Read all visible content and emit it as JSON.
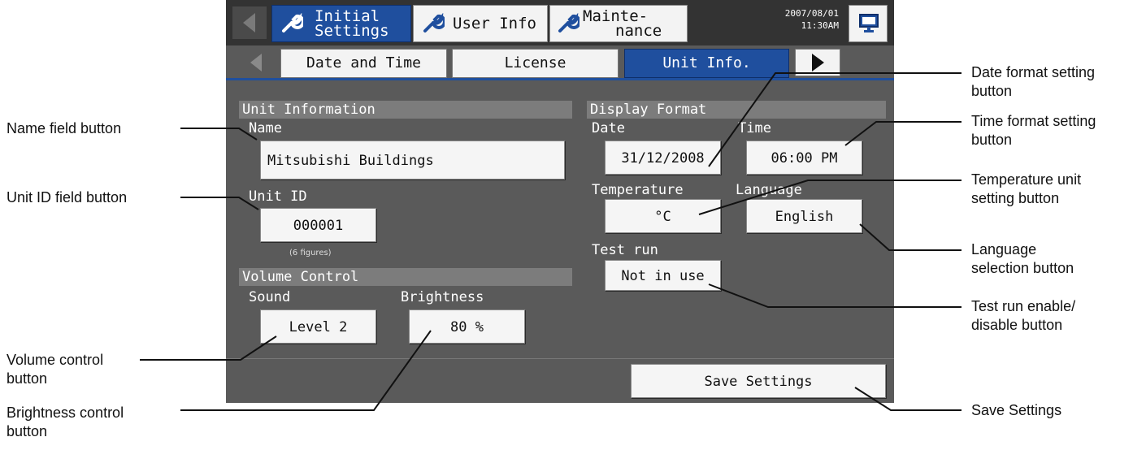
{
  "nav": {
    "tabs": [
      {
        "line1": "Initial",
        "line2": "Settings",
        "active": true
      },
      {
        "line1": "User Info",
        "line2": "",
        "active": false
      },
      {
        "line1": "Mainte-",
        "line2": "nance",
        "active": false
      }
    ],
    "clock": {
      "date": "2007/08/01",
      "time": "11:30AM"
    }
  },
  "subtabs": [
    "Date and Time",
    "License",
    "Unit Info."
  ],
  "unit_info": {
    "section_title": "Unit Information",
    "name_label": "Name",
    "name_value": "Mitsubishi Buildings",
    "unit_id_label": "Unit ID",
    "unit_id_value": "000001",
    "unit_id_note": "(6 figures)"
  },
  "volume": {
    "section_title": "Volume Control",
    "sound_label": "Sound",
    "sound_value": "Level 2",
    "brightness_label": "Brightness",
    "brightness_value": "80 %"
  },
  "display_format": {
    "section_title": "Display Format",
    "date_label": "Date",
    "date_value": "31/12/2008",
    "time_label": "Time",
    "time_value": "06:00 PM",
    "temperature_label": "Temperature",
    "temperature_value": "°C",
    "language_label": "Language",
    "language_value": "English",
    "testrun_label": "Test run",
    "testrun_value": "Not in use"
  },
  "save_label": "Save Settings",
  "callouts": {
    "name": "Name field button",
    "unit_id": "Unit ID field button",
    "volume_l1": "Volume control",
    "volume_l2": "button",
    "brightness_l1": "Brightness control",
    "brightness_l2": "button",
    "date_l1": "Date format setting",
    "date_l2": "button",
    "time_l1": "Time format setting",
    "time_l2": "button",
    "temp_l1": "Temperature unit",
    "temp_l2": "setting button",
    "lang_l1": "Language",
    "lang_l2": "selection button",
    "test_l1": "Test run enable/",
    "test_l2": "disable button",
    "save": "Save Settings"
  }
}
